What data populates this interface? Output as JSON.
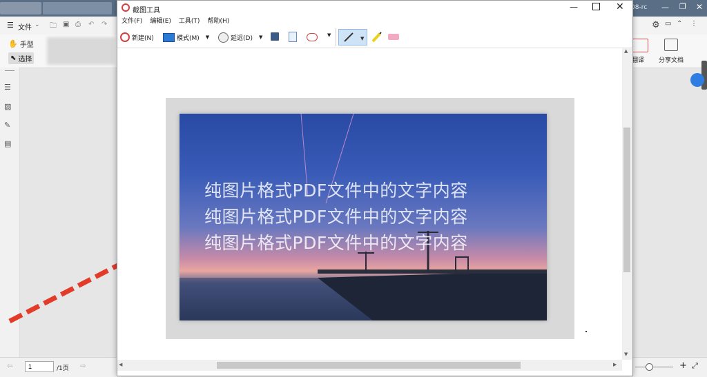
{
  "background_app": {
    "title_suffix": "08-rc",
    "file_menu": "文件",
    "hand_tool": "手型",
    "select_tool": "选择",
    "translate_btn": "翻译",
    "share_btn": "分享文档",
    "page_input": "1",
    "page_total": "/1页"
  },
  "snip_window": {
    "title": "截图工具",
    "menu": [
      "文件(F)",
      "编辑(E)",
      "工具(T)",
      "帮助(H)"
    ],
    "toolbar": {
      "new_label": "新建(N)",
      "mode_label": "模式(M)",
      "delay_label": "延迟(D)"
    }
  },
  "snippet": {
    "lines": [
      "纯图片格式PDF文件中的文字内容",
      "纯图片格式PDF文件中的文字内容",
      "纯图片格式PDF文件中的文字内容"
    ]
  },
  "colors": {
    "arrow": "#e23b2a",
    "pen_active_bg": "#cfe3f7"
  }
}
